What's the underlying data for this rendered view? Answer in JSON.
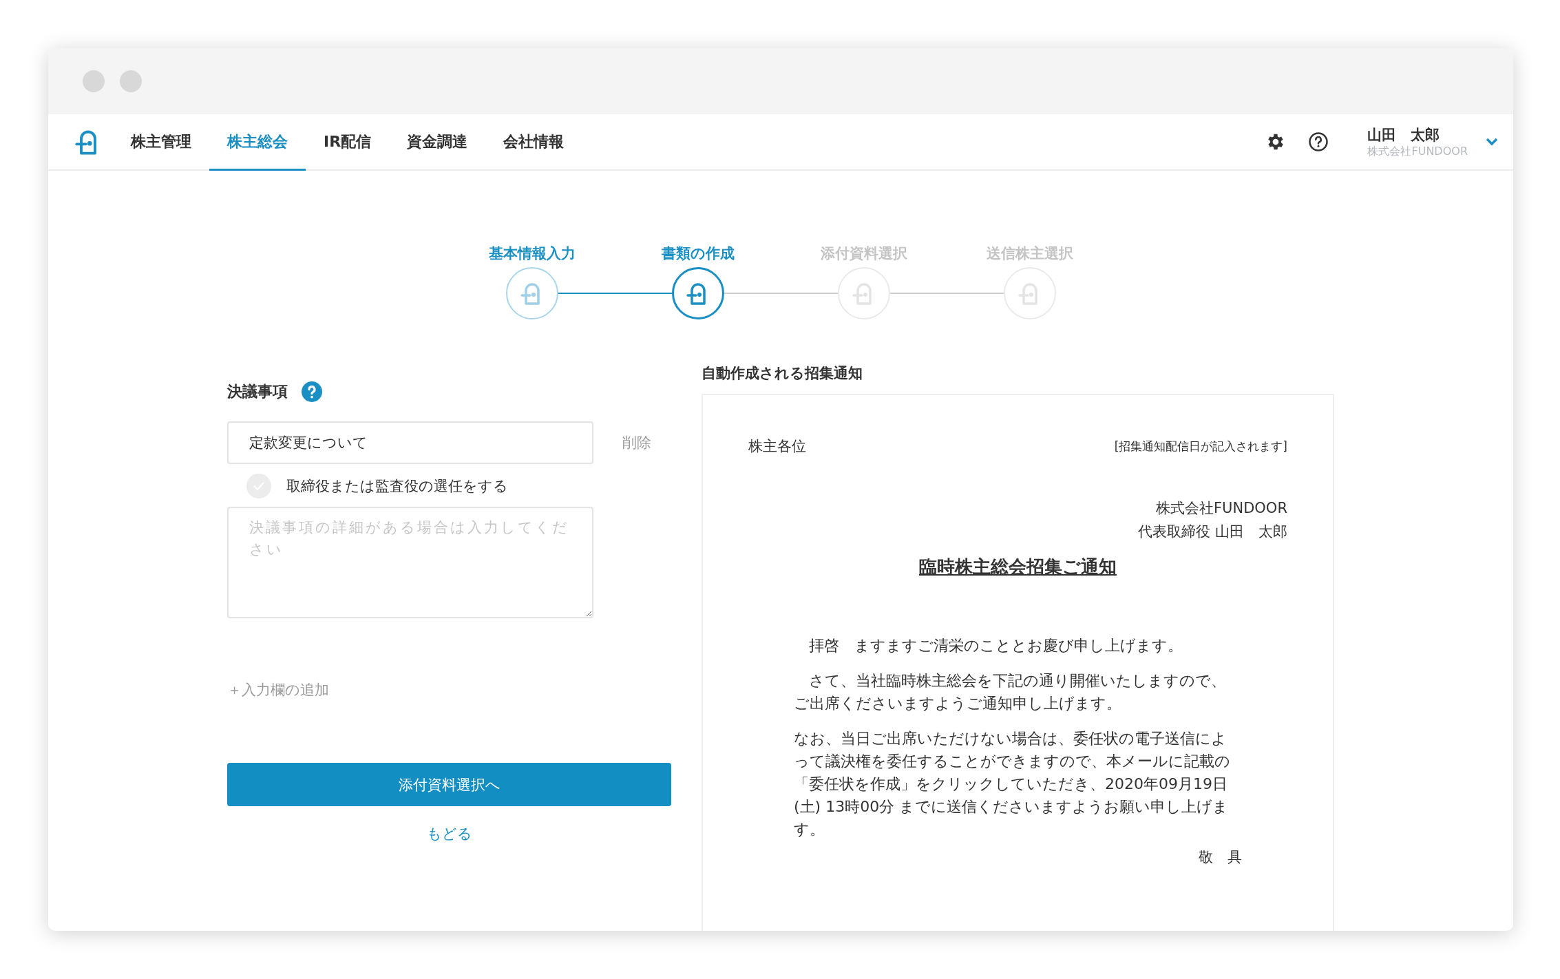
{
  "nav": {
    "tabs": [
      {
        "label": "株主管理",
        "selected": false
      },
      {
        "label": "株主総会",
        "selected": true
      },
      {
        "label": "IR配信",
        "selected": false
      },
      {
        "label": "資金調達",
        "selected": false
      },
      {
        "label": "会社情報",
        "selected": false
      }
    ],
    "user": {
      "name": "山田　太郎",
      "company": "株式会社FUNDOOR"
    }
  },
  "steps": [
    {
      "label": "基本情報入力",
      "done": true,
      "selected": false
    },
    {
      "label": "書類の作成",
      "done": false,
      "selected": true
    },
    {
      "label": "添付資料選択",
      "done": false,
      "selected": false
    },
    {
      "label": "送信株主選択",
      "done": false,
      "selected": false
    }
  ],
  "form": {
    "title": "決議事項",
    "resolution": {
      "value": "定款変更について",
      "delete": "削除",
      "checkbox_label": "取締役または監査役の選任をする",
      "checked": false,
      "details_placeholder": "決議事項の詳細がある場合は入力してください"
    },
    "add_field": "＋入力欄の追加",
    "next_button": "添付資料選択へ",
    "back_link": "もどる"
  },
  "preview": {
    "title": "自動作成される招集通知",
    "addressee": "株主各位",
    "delivery_date_note": "[招集通知配信日が記入されます]",
    "company": "株式会社FUNDOOR",
    "representative": "代表取締役 山田　太郎",
    "heading": "臨時株主総会招集ご通知",
    "paragraphs": [
      "　拝啓　ますますご清栄のこととお慶び申し上げます。",
      "　さて、当社臨時株主総会を下記の通り開催いたしますので、ご出席くださいますようご通知申し上げます。",
      "なお、当日ご出席いただけない場合は、委任状の電子送信によって議決権を委任することができますので、本メールに記載の「委任状を作成」をクリックしていただき、2020年09月19日(土) 13時00分 までに送信くださいますようお願い申し上げます。"
    ],
    "closing": "敬　具"
  }
}
